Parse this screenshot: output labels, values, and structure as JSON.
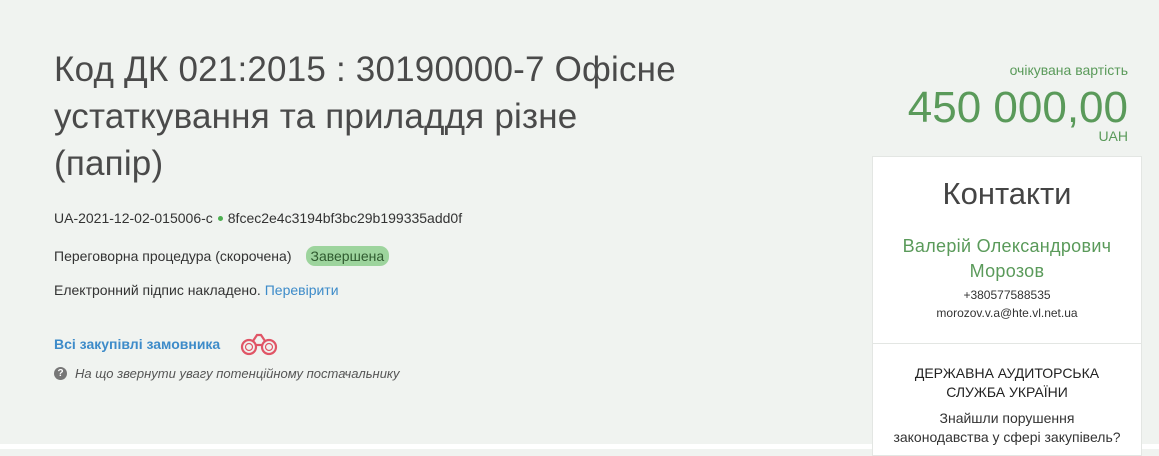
{
  "tender": {
    "title_line1": "Код ДК 021:2015 : 30190000-7 Офісне",
    "title_line2": "устаткування та приладдя різне",
    "title_line3": "(папір)",
    "tender_id": "UA-2021-12-02-015006-c",
    "hash": "8fcec2e4c3194bf3bc29b199335add0f",
    "procedure": "Переговорна процедура (скорочена)",
    "status": "Завершена",
    "signature_text": "Електронний підпис накладено.",
    "signature_link": "Перевірити",
    "all_purchases": "Всі закупівлі замовника",
    "hint": "На що звернути увагу потенційному постачальнику"
  },
  "price": {
    "label": "очікувана вартість",
    "amount": "450 000,00",
    "currency": "UAH"
  },
  "contacts": {
    "title": "Контакти",
    "name_line1": "Валерій Олександрович",
    "name_line2": "Морозов",
    "phone": "+380577588535",
    "email": "morozov.v.a@hte.vl.net.ua"
  },
  "audit": {
    "title_line1": "ДЕРЖАВНА АУДИТОРСЬКА",
    "title_line2": "СЛУЖБА УКРАЇНИ",
    "text_line1": "Знайшли порушення",
    "text_line2": "законодавства у сфері закупівель?"
  },
  "icons": {
    "binoculars": "binoculars-icon",
    "question": "question-icon",
    "status_dot": "dot-icon"
  },
  "colors": {
    "accent_green": "#5a9a5a",
    "link_blue": "#3d8bc9",
    "badge_green": "#9dd49d",
    "binoculars_red": "#e05566"
  }
}
